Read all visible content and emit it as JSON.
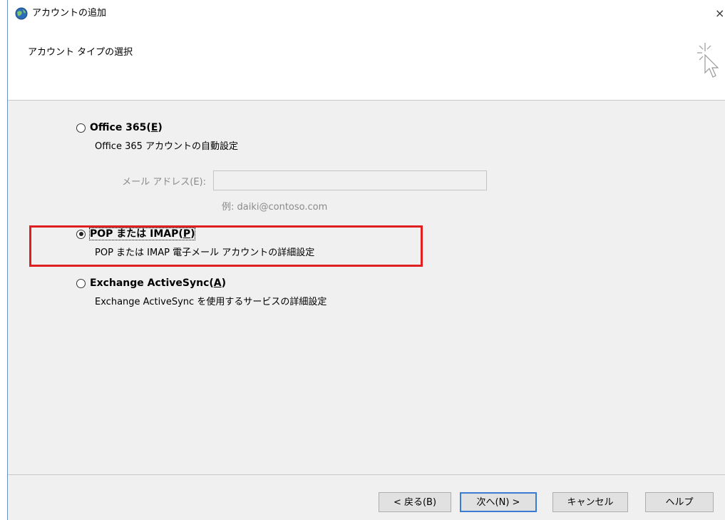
{
  "window": {
    "title": "アカウントの追加",
    "close_glyph": "×"
  },
  "header": {
    "title": "アカウント タイプの選択"
  },
  "options": {
    "office365": {
      "label": "Office 365(E)",
      "label_prefix": "Office 365(",
      "label_key": "E",
      "label_suffix": ")",
      "description": "Office 365 アカウントの自動設定",
      "checked": false,
      "email_label": "メール アドレス(E):",
      "email_value": "",
      "email_example": "例: daiki@contoso.com"
    },
    "pop_imap": {
      "label": "POP または IMAP(P)",
      "label_prefix": "POP または IMAP(",
      "label_key": "P",
      "label_suffix": ")",
      "description": "POP または IMAP 電子メール アカウントの詳細設定",
      "checked": true
    },
    "exchange": {
      "label": "Exchange ActiveSync(A)",
      "label_prefix": "Exchange ActiveSync(",
      "label_key": "A",
      "label_suffix": ")",
      "description": "Exchange ActiveSync を使用するサービスの詳細設定",
      "checked": false
    }
  },
  "buttons": {
    "back": "< 戻る(B)",
    "next": "次へ(N) >",
    "cancel": "キャンセル",
    "help": "ヘルプ"
  },
  "colors": {
    "highlight": "#e02020",
    "default_button_border": "#3a7bd5",
    "content_bg": "#f0f0f0"
  },
  "icons": {
    "title": "outlook-globe-icon",
    "wizard": "sparkle-cursor-icon",
    "close": "close-icon"
  }
}
